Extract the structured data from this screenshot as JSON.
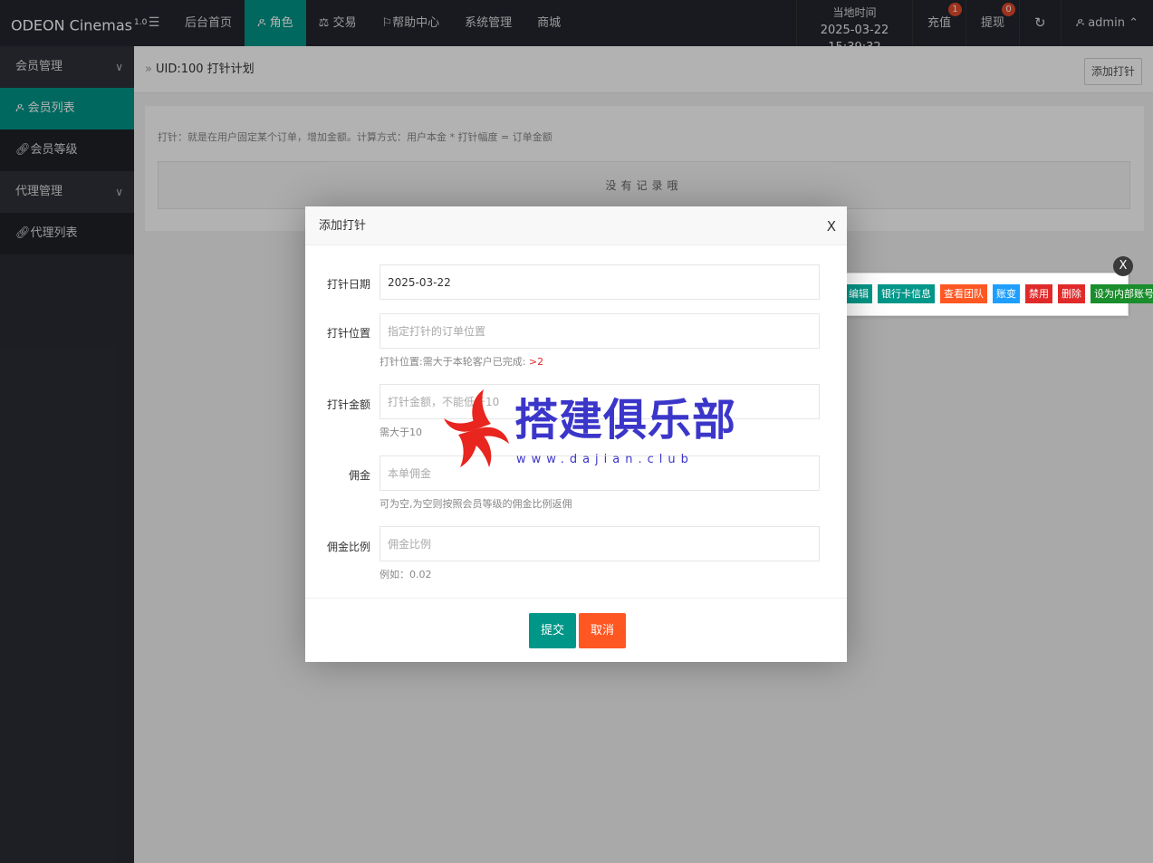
{
  "header": {
    "logo": "ODEON Cinemas",
    "version": "1.0",
    "menu_toggle": "☰",
    "nav": [
      {
        "label": "后台首页",
        "icon": ""
      },
      {
        "label": "角色",
        "icon": "user-icon",
        "active": true
      },
      {
        "label": "交易",
        "icon": "scale-icon"
      },
      {
        "label": "帮助中心",
        "icon": "flag-icon"
      },
      {
        "label": "系统管理",
        "icon": ""
      },
      {
        "label": "商城",
        "icon": ""
      }
    ],
    "clock_label": "当地时间",
    "clock_time": "2025-03-22 15:39:32",
    "recharge": "充值",
    "recharge_badge": "1",
    "withdraw": "提现",
    "withdraw_badge": "0",
    "refresh_icon": "↻",
    "user": "admin"
  },
  "sidebar": {
    "groups": [
      {
        "label": "会员管理",
        "items": [
          {
            "label": "会员列表",
            "active": true
          },
          {
            "label": "会员等级"
          }
        ]
      },
      {
        "label": "代理管理",
        "items": [
          {
            "label": "代理列表"
          }
        ]
      }
    ]
  },
  "main": {
    "breadcrumb_sep": "»",
    "breadcrumb": "UID:100 打针计划",
    "add_button": "添加打针",
    "note": "打针：就是在用户固定某个订单，增加金额。计算方式：用户本金 * 打针幅度 = 订单金额",
    "no_records": "没有记录哦"
  },
  "popup": {
    "buttons": [
      {
        "label": "编辑",
        "color": "#009688"
      },
      {
        "label": "银行卡信息",
        "color": "#009688"
      },
      {
        "label": "查看团队",
        "color": "#ff5722"
      },
      {
        "label": "账变",
        "color": "#1e9fff"
      },
      {
        "label": "禁用",
        "color": "#e02a2a"
      },
      {
        "label": "删除",
        "color": "#e02a2a"
      },
      {
        "label": "设为内部账号",
        "color": "#1a8d2c"
      }
    ],
    "close": "X"
  },
  "modal": {
    "title": "添加打针",
    "close": "X",
    "fields": [
      {
        "label": "打针日期",
        "value": "2025-03-22",
        "placeholder": ""
      },
      {
        "label": "打针位置",
        "value": "",
        "placeholder": "指定打针的订单位置",
        "help": "打针位置:需大于本轮客户已完成:",
        "help_red": ">2"
      },
      {
        "label": "打针金额",
        "value": "",
        "placeholder": "打针金额，不能低于10",
        "help": "需大于10"
      },
      {
        "label": "佣金",
        "value": "",
        "placeholder": "本单佣金",
        "help": "可为空,为空则按照会员等级的佣金比例返佣"
      },
      {
        "label": "佣金比例",
        "value": "",
        "placeholder": "佣金比例",
        "help": "例如：0.02"
      }
    ],
    "submit": "提交",
    "cancel": "取消"
  },
  "watermark": {
    "text": "搭建俱乐部",
    "url": "www.dajian.club"
  },
  "colors": {
    "accent": "#009688",
    "danger": "#ff5722",
    "header_bg": "#23262e",
    "sidebar_bg": "#2a2c33"
  }
}
